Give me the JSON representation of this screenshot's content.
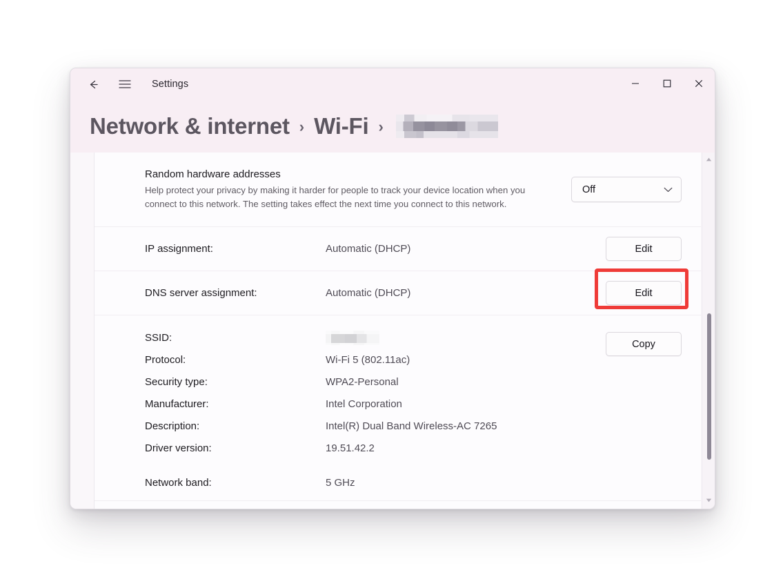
{
  "window": {
    "app_title": "Settings",
    "back_icon": "arrow-left-icon",
    "menu_icon": "hamburger-menu-icon",
    "minimize_label": "—",
    "maximize_label": "☐",
    "close_label": "✕"
  },
  "breadcrumb": {
    "items": [
      "Network & internet",
      "Wi-Fi"
    ],
    "separator": "›",
    "redacted_network": "",
    "redacted": true
  },
  "main": {
    "random_hardware": {
      "title": "Random hardware addresses",
      "description": "Help protect your privacy by making it harder for people to track your device location when you connect to this network. The setting takes effect the next time you connect to this network.",
      "dropdown_value": "Off",
      "dropdown_icon": "chevron-down-icon"
    },
    "ip_assignment": {
      "label": "IP assignment:",
      "value": "Automatic (DHCP)",
      "button": "Edit"
    },
    "dns_assignment": {
      "label": "DNS server assignment:",
      "value": "Automatic (DHCP)",
      "button": "Edit",
      "highlighted": true,
      "highlight_color": "#ef3b38"
    },
    "properties": {
      "copy_button": "Copy",
      "items": [
        {
          "key": "SSID:",
          "value": "",
          "redacted": true
        },
        {
          "key": "Protocol:",
          "value": "Wi-Fi 5 (802.11ac)",
          "redacted": false
        },
        {
          "key": "Security type:",
          "value": "WPA2-Personal",
          "redacted": false
        },
        {
          "key": "Manufacturer:",
          "value": "Intel Corporation",
          "redacted": false
        },
        {
          "key": "Description:",
          "value": "Intel(R) Dual Band Wireless-AC 7265",
          "redacted": false
        },
        {
          "key": "Driver version:",
          "value": "19.51.42.2",
          "redacted": false
        }
      ]
    },
    "network_band": {
      "label": "Network band:",
      "value": "5 GHz"
    }
  },
  "scrollbar": {
    "up_icon": "triangle-up-icon",
    "down_icon": "triangle-down-icon"
  }
}
